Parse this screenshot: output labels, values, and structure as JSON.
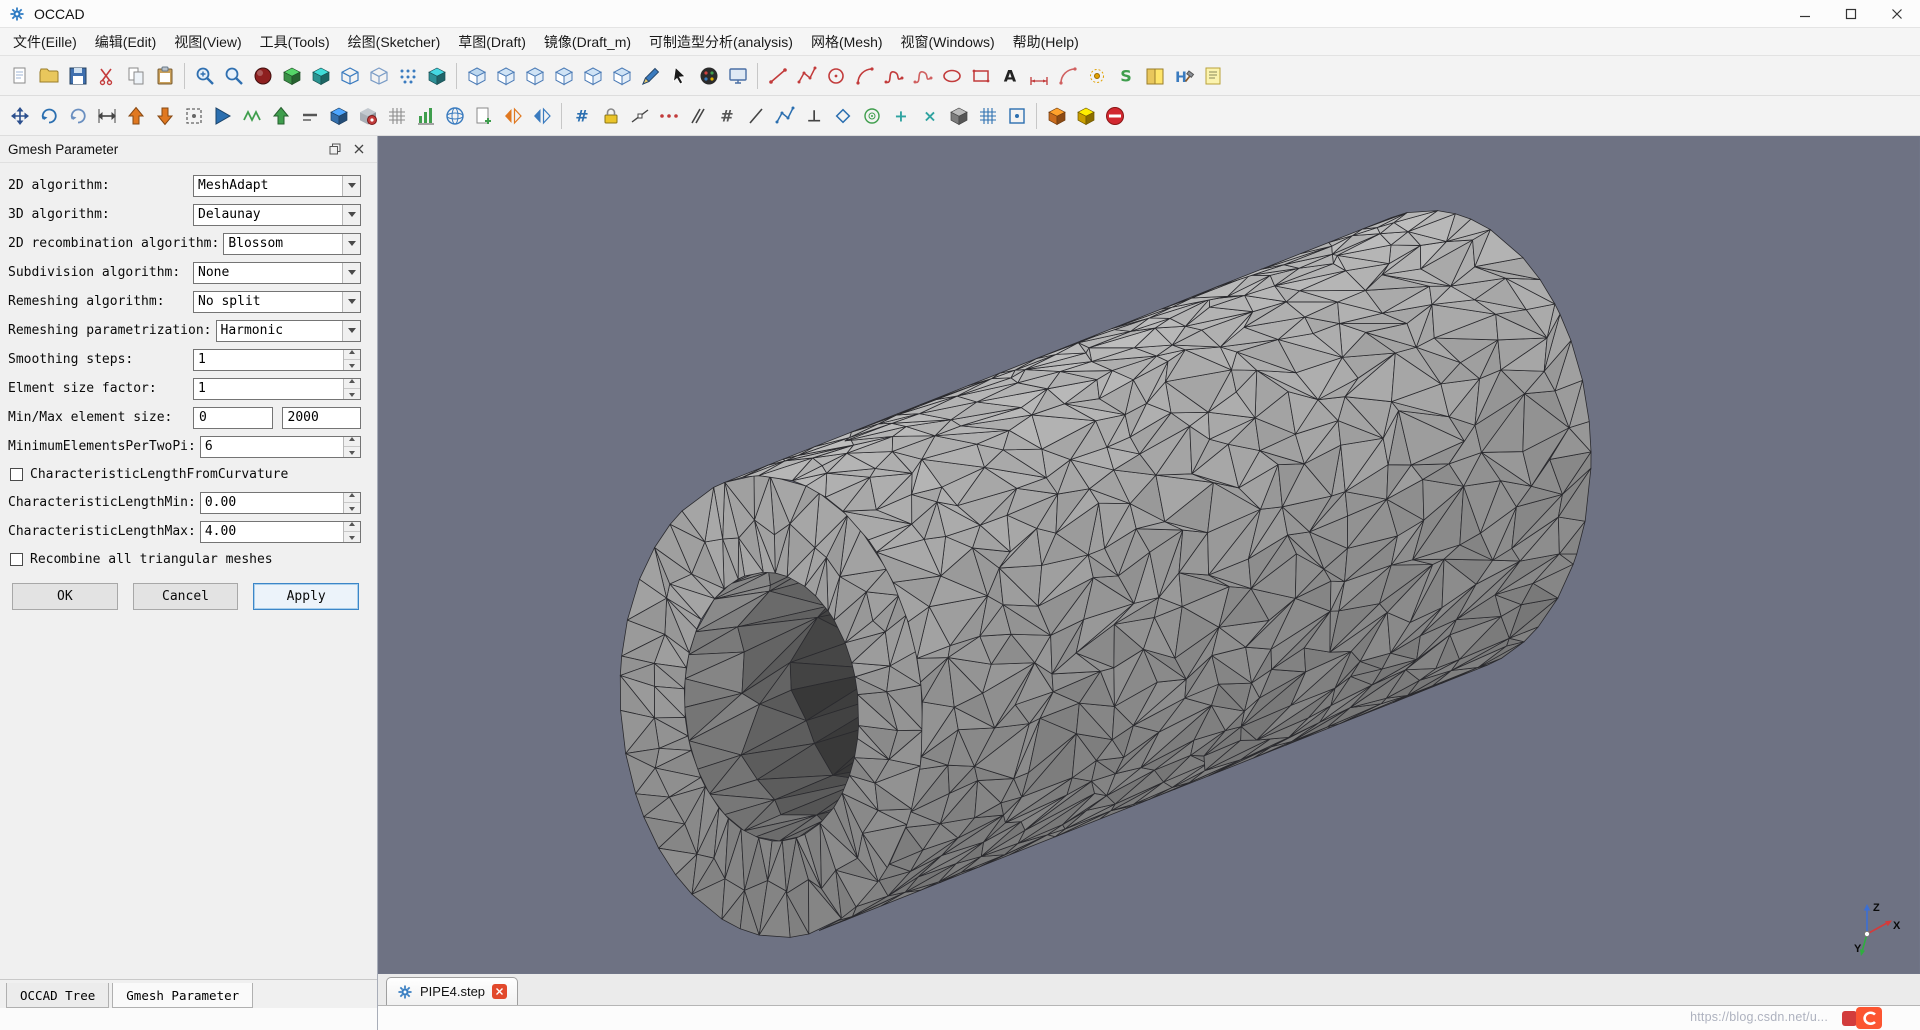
{
  "window": {
    "title": "OCCAD"
  },
  "menu": {
    "items": [
      {
        "id": "file",
        "label": "文件(Eille)"
      },
      {
        "id": "edit",
        "label": "编辑(Edit)"
      },
      {
        "id": "view",
        "label": "视图(View)"
      },
      {
        "id": "tools",
        "label": "工具(Tools)"
      },
      {
        "id": "sketcher",
        "label": "绘图(Sketcher)"
      },
      {
        "id": "draft",
        "label": "草图(Draft)"
      },
      {
        "id": "draft-m",
        "label": "镜像(Draft_m)"
      },
      {
        "id": "analysis",
        "label": "可制造型分析(analysis)"
      },
      {
        "id": "mesh",
        "label": "网格(Mesh)"
      },
      {
        "id": "windows",
        "label": "视窗(Windows)"
      },
      {
        "id": "help",
        "label": "帮助(Help)"
      }
    ]
  },
  "toolbar_main": {
    "icons": [
      {
        "n": "new-file-icon",
        "k": "page",
        "c": "#ffffff"
      },
      {
        "n": "open-file-icon",
        "k": "folder",
        "c": "#e9c75c"
      },
      {
        "n": "save-file-icon",
        "k": "floppy",
        "c": "#3f6fae"
      },
      {
        "n": "cut-icon",
        "k": "scissors",
        "c": "#c43c3c"
      },
      {
        "n": "copy-icon",
        "k": "copy",
        "c": "#9aa7b8"
      },
      {
        "n": "paste-icon",
        "k": "clip",
        "c": "#c9a05a"
      },
      {
        "sep": true
      },
      {
        "n": "zoom-fit-icon",
        "k": "magp",
        "c": "#2f6fb0"
      },
      {
        "n": "zoom-icon",
        "k": "mag",
        "c": "#2f6fb0"
      },
      {
        "n": "shaded-sphere-icon",
        "k": "sphere",
        "c": "#8e1f1f"
      },
      {
        "n": "solid-view-icon",
        "k": "cube",
        "c": "#3f9e4d"
      },
      {
        "n": "shaded-view-icon",
        "k": "cube",
        "c": "#2fa3a0"
      },
      {
        "n": "wireframe-view-icon",
        "k": "cubewire",
        "c": "#3a7bbf"
      },
      {
        "n": "hidden-line-view-icon",
        "k": "cubewire",
        "c": "#7a9cc6"
      },
      {
        "n": "points-view-icon",
        "k": "dots",
        "c": "#3a7bbf"
      },
      {
        "n": "mesh-view-icon",
        "k": "cube",
        "c": "#33a0a8"
      },
      {
        "sep": true
      },
      {
        "n": "view-isometric-icon",
        "k": "viewcube",
        "c": "#bcd7ef"
      },
      {
        "n": "view-front-icon",
        "k": "viewcube",
        "c": "#cfe3f5"
      },
      {
        "n": "view-top-icon",
        "k": "viewcube",
        "c": "#cfe3f5"
      },
      {
        "n": "view-right-icon",
        "k": "viewcube",
        "c": "#cfe3f5"
      },
      {
        "n": "view-left-icon",
        "k": "viewcube",
        "c": "#cfe3f5"
      },
      {
        "n": "view-bottom-icon",
        "k": "viewcube",
        "c": "#cfe3f5"
      },
      {
        "n": "section-cut-icon",
        "k": "pen",
        "c": "#3a7bbf"
      },
      {
        "n": "select-arrow-icon",
        "k": "cursor",
        "c": "#111111"
      },
      {
        "n": "color-palette-icon",
        "k": "palette",
        "c": "#222222"
      },
      {
        "n": "snapshot-icon",
        "k": "screen",
        "c": "#4a6fa5"
      },
      {
        "sep": true
      },
      {
        "n": "draw-line-icon",
        "k": "sline",
        "c": "#c23b3b"
      },
      {
        "n": "draw-polyline-icon",
        "k": "spoly",
        "c": "#c23b3b"
      },
      {
        "n": "draw-circle-icon",
        "k": "scircle",
        "c": "#c23b3b"
      },
      {
        "n": "draw-arc-icon",
        "k": "sarc",
        "c": "#c23b3b"
      },
      {
        "n": "draw-spline-icon",
        "k": "sspline",
        "c": "#c23b3b"
      },
      {
        "n": "draw-bezier-icon",
        "k": "sspline",
        "c": "#d06060"
      },
      {
        "n": "draw-ellipse-icon",
        "k": "sellipse",
        "c": "#c23b3b"
      },
      {
        "n": "draw-rectangle-icon",
        "k": "srect",
        "c": "#c23b3b"
      },
      {
        "n": "draw-text-icon",
        "k": "glyph",
        "c": "#222222",
        "ch": "A"
      },
      {
        "n": "dimension-icon",
        "k": "dim",
        "c": "#c23b3b"
      },
      {
        "n": "dimension-angle-icon",
        "k": "sarc",
        "c": "#d06060"
      },
      {
        "n": "draw-point-icon",
        "k": "dotc",
        "c": "#e0a000"
      },
      {
        "n": "bspline-icon",
        "k": "glyph",
        "c": "#3f9e4d",
        "ch": "S"
      },
      {
        "n": "sketch-sheet-icon",
        "k": "book",
        "c": "#e9c75c"
      },
      {
        "n": "toolkit-icon",
        "k": "hammer",
        "c": "#3a7bbf"
      },
      {
        "n": "annotation-icon",
        "k": "note",
        "c": "#e9c75c"
      }
    ]
  },
  "toolbar_modify": {
    "icons": [
      {
        "n": "pan-icon",
        "k": "movecross",
        "c": "#2b4f8e"
      },
      {
        "n": "rotate-left-icon",
        "k": "rot",
        "c": "#2b6fb0"
      },
      {
        "n": "rotate-right-icon",
        "k": "rot",
        "c": "#6a8fc0"
      },
      {
        "n": "stretch-icon",
        "k": "resizeh",
        "c": "#444444"
      },
      {
        "n": "move-up-icon",
        "k": "arrowup",
        "c": "#e07820"
      },
      {
        "n": "move-down-icon",
        "k": "arrowdn",
        "c": "#e07820"
      },
      {
        "n": "fit-selection-icon",
        "k": "frame",
        "c": "#666666"
      },
      {
        "n": "mirror-icon",
        "k": "wedge",
        "c": "#2b6fb0"
      },
      {
        "n": "ruled-surface-icon",
        "k": "zigzag",
        "c": "#3f9e4d"
      },
      {
        "n": "upgrade-icon",
        "k": "arrowup",
        "c": "#3f9e4d"
      },
      {
        "n": "downgrade-icon",
        "k": "dash",
        "c": "#555555"
      },
      {
        "n": "cube-tool-icon",
        "k": "cube",
        "c": "#3a7bbf"
      },
      {
        "n": "mesh-from-shape-icon",
        "k": "gearcube",
        "c": "#c23b3b"
      },
      {
        "n": "table-icon",
        "k": "grid",
        "c": "#8a8a8a"
      },
      {
        "n": "evaluate-mesh-icon",
        "k": "chart",
        "c": "#3f9e4d"
      },
      {
        "n": "sphere-mesh-icon",
        "k": "globe",
        "c": "#3a7bbf"
      },
      {
        "n": "add-document-icon",
        "k": "docplus",
        "c": "#3f9e4d"
      },
      {
        "n": "scale-icon",
        "k": "fliptri",
        "c": "#e07820"
      },
      {
        "n": "flip-normals-icon",
        "k": "fliptri",
        "c": "#3a7bbf"
      },
      {
        "sep": true
      },
      {
        "n": "snap-grid-icon",
        "k": "glyph",
        "c": "#2b6fb0",
        "ch": "#"
      },
      {
        "n": "snap-lock-icon",
        "k": "lock",
        "c": "#eac42a"
      },
      {
        "n": "snap-endpoint-icon",
        "k": "snapline",
        "c": "#444444"
      },
      {
        "n": "snap-midpoint-icon",
        "k": "dots3",
        "c": "#c23b3b"
      },
      {
        "n": "snap-parallel-icon",
        "k": "parallel",
        "c": "#444444"
      },
      {
        "n": "snap-grid2-icon",
        "k": "glyph",
        "c": "#555555",
        "ch": "#"
      },
      {
        "n": "snap-extension-icon",
        "k": "slash",
        "c": "#444444"
      },
      {
        "n": "snap-angle-icon",
        "k": "spoly",
        "c": "#2b6fb0"
      },
      {
        "n": "snap-perpendicular-icon",
        "k": "glyph",
        "c": "#444444",
        "ch": "⊥"
      },
      {
        "n": "snap-special-icon",
        "k": "diamond",
        "c": "#2b6fb0"
      },
      {
        "n": "snap-center-icon",
        "k": "target",
        "c": "#3f9e4d"
      },
      {
        "n": "snap-intersection-icon",
        "k": "glyph",
        "c": "#2fa3a0",
        "ch": "+"
      },
      {
        "n": "snap-near-icon",
        "k": "glyph",
        "c": "#2fa3a0",
        "ch": "×"
      },
      {
        "n": "working-plane-icon",
        "k": "cube",
        "c": "#8a8a8a"
      },
      {
        "n": "dimension-grid-icon",
        "k": "grid",
        "c": "#2b6fb0"
      },
      {
        "n": "toggle-grid-icon",
        "k": "sqdot",
        "c": "#2b6fb0"
      },
      {
        "sep": true
      },
      {
        "n": "mesh-export-icon",
        "k": "cube",
        "c": "#e07820"
      },
      {
        "n": "mesh-import-icon",
        "k": "cube",
        "c": "#e0b000"
      },
      {
        "n": "stop-operation-icon",
        "k": "noentry",
        "c": "#d22830"
      }
    ]
  },
  "panel": {
    "title": "Gmesh Parameter",
    "rows": [
      {
        "name": "algorithm-2d",
        "label": "2D algorithm:",
        "type": "combo",
        "value": "MeshAdapt"
      },
      {
        "name": "algorithm-3d",
        "label": "3D algorithm:",
        "type": "combo",
        "value": "Delaunay"
      },
      {
        "name": "recombination-2d",
        "label": "2D recombination algorithm:",
        "type": "combo",
        "value": "Blossom"
      },
      {
        "name": "subdivision-algorithm",
        "label": "Subdivision algorithm:",
        "type": "combo",
        "value": "None"
      },
      {
        "name": "remeshing-algorithm",
        "label": "Remeshing algorithm:",
        "type": "combo",
        "value": "No split"
      },
      {
        "name": "remeshing-parametrization",
        "label": "Remeshing parametrization:",
        "type": "combo",
        "value": "Harmonic"
      },
      {
        "name": "smoothing-steps",
        "label": "Smoothing steps:",
        "type": "spin",
        "value": "1"
      },
      {
        "name": "element-size-factor",
        "label": "Elment size factor:",
        "type": "spin",
        "value": "1"
      },
      {
        "name": "min-max-element-size",
        "label": "Min/Max element size:",
        "type": "pair",
        "value": "0",
        "value2": "2000"
      },
      {
        "name": "minimum-elements-per-two-pi",
        "label": "MinimumElementsPerTwoPi:",
        "type": "spin",
        "value": "6"
      },
      {
        "name": "characteristic-length-from-curvature",
        "label": "CharacteristicLengthFromCurvature",
        "type": "check",
        "checked": false
      },
      {
        "name": "characteristic-length-min",
        "label": "CharacteristicLengthMin:",
        "type": "spin",
        "value": "0.00"
      },
      {
        "name": "characteristic-length-max",
        "label": "CharacteristicLengthMax:",
        "type": "spin",
        "value": "4.00"
      },
      {
        "name": "recombine-all-triangular-meshes",
        "label": "Recombine all triangular meshes",
        "type": "check",
        "checked": false
      }
    ],
    "buttons": [
      {
        "name": "ok-button",
        "label": "OK",
        "accent": false
      },
      {
        "name": "cancel-button",
        "label": "Cancel",
        "accent": false
      },
      {
        "name": "apply-button",
        "label": "Apply",
        "accent": true
      }
    ]
  },
  "dock_tabs": [
    {
      "name": "occad-tree-tab",
      "label": "OCCAD Tree",
      "active": false
    },
    {
      "name": "gmesh-parameter-tab",
      "label": "Gmesh Parameter",
      "active": true
    }
  ],
  "viewport": {
    "file_tab": "PIPE4.step",
    "axes": {
      "x": "X",
      "y": "Y",
      "z": "Z"
    },
    "watermark": "https://blog.csdn.net/u..."
  },
  "colors": {
    "viewport_background": "#6e7283",
    "mesh_fill": "#9b9b9b",
    "mesh_line": "#2a2a2e",
    "accent_blue": "#3c86c8",
    "file_tab_close": "#e2492c"
  }
}
